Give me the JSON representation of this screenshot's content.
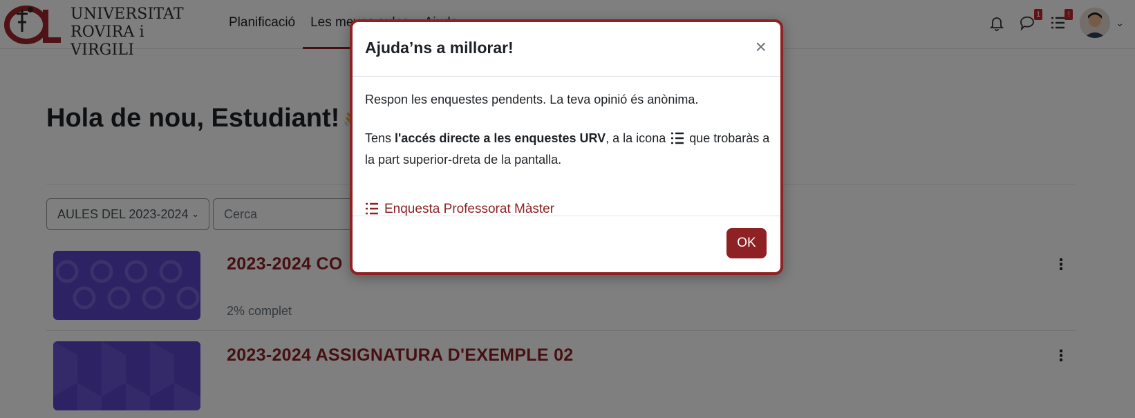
{
  "header": {
    "logo_line1": "UNIVERSITAT",
    "logo_line2": "ROVIRA i VIRGILI",
    "nav": [
      {
        "label": "Planificació"
      },
      {
        "label": "Les meves aules"
      },
      {
        "label": "Ajuda ⌄"
      }
    ],
    "messages_badge": "1",
    "surveys_badge": "!"
  },
  "main": {
    "greeting": "Hola de nou, Estudiant!",
    "greeting_emoji": "👋",
    "filter_value": "AULES DEL 2023-2024",
    "search_placeholder": "Cerca",
    "courses": [
      {
        "title": "2023-2024 CO",
        "progress": "2% complet",
        "progress_value": 2
      },
      {
        "title": "2023-2024 ASSIGNATURA D'EXEMPLE 02"
      }
    ]
  },
  "modal": {
    "title": "Ajuda’ns a millorar!",
    "close_glyph": "×",
    "line1": "Respon les enquestes pendents. La teva opinió és anònima.",
    "line2_prefix": "Tens ",
    "line2_bold": "l'accés directe a les enquestes URV",
    "line2_mid": ", a la icona ",
    "line2_suffix": " que trobaràs a la part superior-dreta de la pantalla.",
    "link_label": "Enquesta Professorat Màster",
    "ok_label": "OK"
  },
  "colors": {
    "brand": "#8d2124",
    "badge": "#c0272d",
    "course_card": "#5b45c9"
  },
  "icons": [
    "logo-icon",
    "bell-icon",
    "chat-icon",
    "survey-list-icon",
    "avatar",
    "kebab-icon",
    "close-icon"
  ]
}
